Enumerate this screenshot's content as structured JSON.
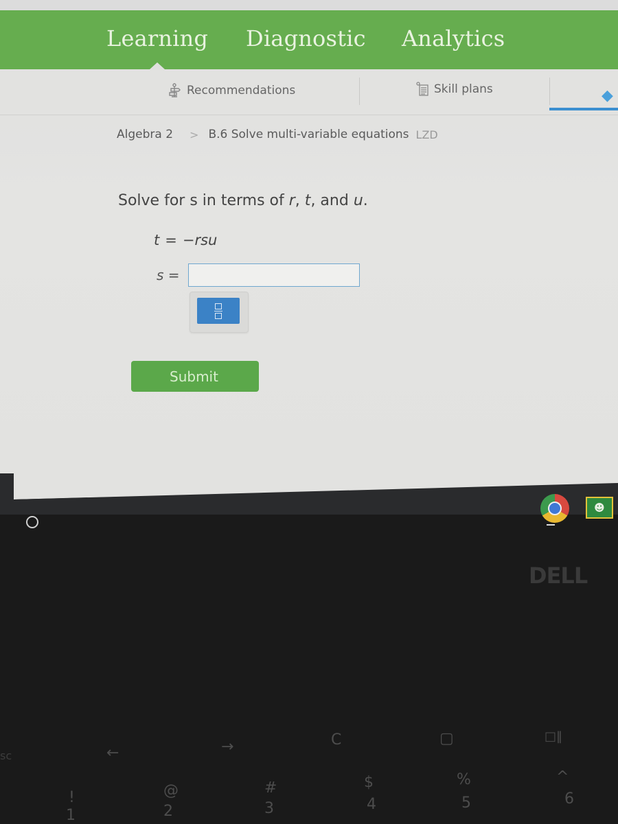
{
  "top_nav": {
    "items": [
      {
        "label": "Learning",
        "active": true
      },
      {
        "label": "Diagnostic",
        "active": false
      },
      {
        "label": "Analytics",
        "active": false
      }
    ]
  },
  "sub_nav": {
    "items": [
      {
        "label": "Recommendations",
        "icon": "signpost-icon"
      },
      {
        "label": "Skill plans",
        "icon": "checklist-icon"
      }
    ],
    "partial_icon": "diamond-icon"
  },
  "breadcrumb": {
    "subject": "Algebra 2",
    "separator": ">",
    "skill": "B.6 Solve multi-variable equations",
    "code": "LZD"
  },
  "problem": {
    "prompt_prefix": "Solve for ",
    "target_var": "s",
    "prompt_middle": " in terms of ",
    "var_r": "r",
    "comma1": ", ",
    "var_t": "t",
    "prompt_and": ", and ",
    "var_u": "u",
    "prompt_suffix": ".",
    "equation_lhs": "t",
    "equation_eq": "=",
    "equation_rhs": "−rsu",
    "answer_lhs": "s",
    "answer_eq": "=",
    "answer_value": ""
  },
  "keypad": {
    "fraction_button": "fraction"
  },
  "submit_label": "Submit",
  "shelf": {
    "apps": [
      "Chrome",
      "Google Classroom"
    ],
    "brand": "DELL"
  },
  "keyboard": {
    "function_keys": [
      "sc",
      "←",
      "→",
      "C",
      "▢",
      "□‖"
    ],
    "number_keys": [
      {
        "top": "!",
        "bottom": "1"
      },
      {
        "top": "@",
        "bottom": "2"
      },
      {
        "top": "#",
        "bottom": "3"
      },
      {
        "top": "$",
        "bottom": "4"
      },
      {
        "top": "%",
        "bottom": "5"
      },
      {
        "top": "^",
        "bottom": "6"
      }
    ]
  }
}
